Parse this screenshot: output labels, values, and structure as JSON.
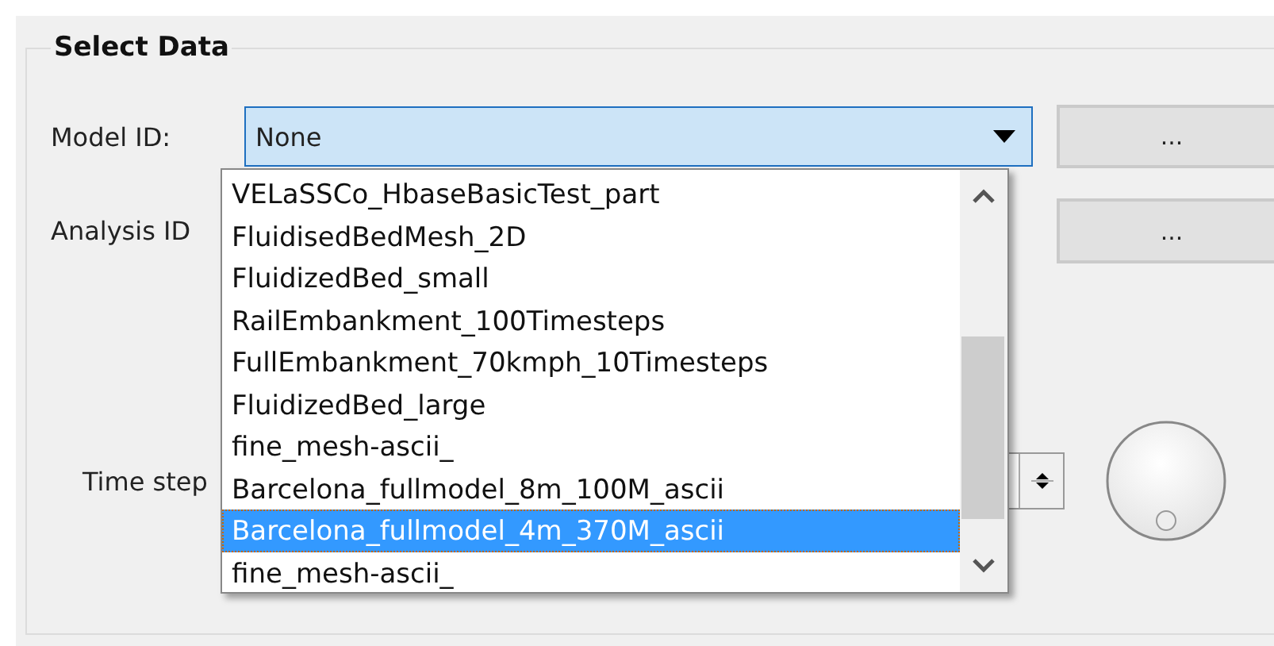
{
  "group": {
    "title": "Select Data"
  },
  "model_id": {
    "label": "Model ID:",
    "value": "None",
    "button": "..."
  },
  "analysis_id": {
    "label": "Analysis ID",
    "button": "..."
  },
  "time_step": {
    "label": "Time step"
  },
  "dropdown": {
    "items": [
      {
        "label": "VELaSSCo_HbaseBasicTest_part",
        "selected": false
      },
      {
        "label": "FluidisedBedMesh_2D",
        "selected": false
      },
      {
        "label": "FluidizedBed_small",
        "selected": false
      },
      {
        "label": "RailEmbankment_100Timesteps",
        "selected": false
      },
      {
        "label": "FullEmbankment_70kmph_10Timesteps",
        "selected": false
      },
      {
        "label": "FluidizedBed_large",
        "selected": false
      },
      {
        "label": "fine_mesh-ascii_",
        "selected": false
      },
      {
        "label": "Barcelona_fullmodel_8m_100M_ascii",
        "selected": false
      },
      {
        "label": "Barcelona_fullmodel_4m_370M_ascii",
        "selected": true
      },
      {
        "label": "fine_mesh-ascii_",
        "selected": false
      }
    ]
  }
}
